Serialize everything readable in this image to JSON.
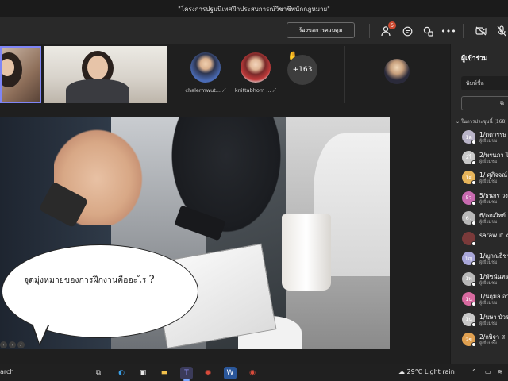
{
  "window": {
    "title": "\"โครงการปฐมนิเทศฝึกประสบการณ์วิชาชีพนักกฎหมาย\""
  },
  "toolbar": {
    "control_label": "ร้องขอการควบคุม",
    "participants_badge": "5",
    "icons": [
      "people-icon",
      "chat-icon",
      "reactions-icon",
      "more-icon",
      "camera-icon",
      "mic-icon"
    ]
  },
  "video_strip": {
    "participants": [
      {
        "name": "chalermwut..."
      },
      {
        "name": "knittabhom ..."
      }
    ],
    "overflow_count": "+163"
  },
  "slide": {
    "bubble_text": "จุดมุ่งหมายของการฝึกงานคืออะไร",
    "question_mark": "?"
  },
  "panel": {
    "title": "ผู้เข้าร่วม",
    "search_placeholder": "พิมพ์ชื่อ",
    "section_label": "ในการประชุมนี้ (168)",
    "participants": [
      {
        "initials": "1ต",
        "name": "1/ตดวรรษ",
        "role": "ผู้เยี่ยมชม",
        "color": "#b9b4c8"
      },
      {
        "initials": "2ไ",
        "name": "2/พรนภา ไ",
        "role": "ผู้เยี่ยมชม",
        "color": "#c8c8c8"
      },
      {
        "initials": "1ศ",
        "name": "1/ ศุภิจจณ์",
        "role": "ผู้เยี่ยมชม",
        "color": "#e6b45a"
      },
      {
        "initials": "5ว",
        "name": "5/ธนกร วง",
        "role": "ผู้เยี่ยมชม",
        "color": "#c86ab0"
      },
      {
        "initials": "6ว",
        "name": "6/เจนวิทย์",
        "role": "ผู้เยี่ยมชม",
        "color": "#b8b8b8"
      },
      {
        "initials": "",
        "name": "sarawut ka",
        "role": "",
        "color": "#7a3a3a"
      },
      {
        "initials": "1ญ",
        "name": "1/ญาณธิชา",
        "role": "ผู้เยี่ยมชม",
        "color": "#a8a6d8"
      },
      {
        "initials": "1พ",
        "name": "1/พัชนันทร",
        "role": "ผู้เยี่ยมชม",
        "color": "#b8b8b8"
      },
      {
        "initials": "1น",
        "name": "1/นฤมล อ่า",
        "role": "ผู้เยี่ยมชม",
        "color": "#d86aa0"
      },
      {
        "initials": "1น",
        "name": "1/นษา บัวร",
        "role": "ผู้เยี่ยมชม",
        "color": "#c8c8c8"
      },
      {
        "initials": "2ข",
        "name": "2/กษิฐา ส",
        "role": "ผู้เยี่ยมชม",
        "color": "#e0a050"
      }
    ]
  },
  "taskbar": {
    "search_label": "arch",
    "weather": "29°C  Light rain"
  }
}
